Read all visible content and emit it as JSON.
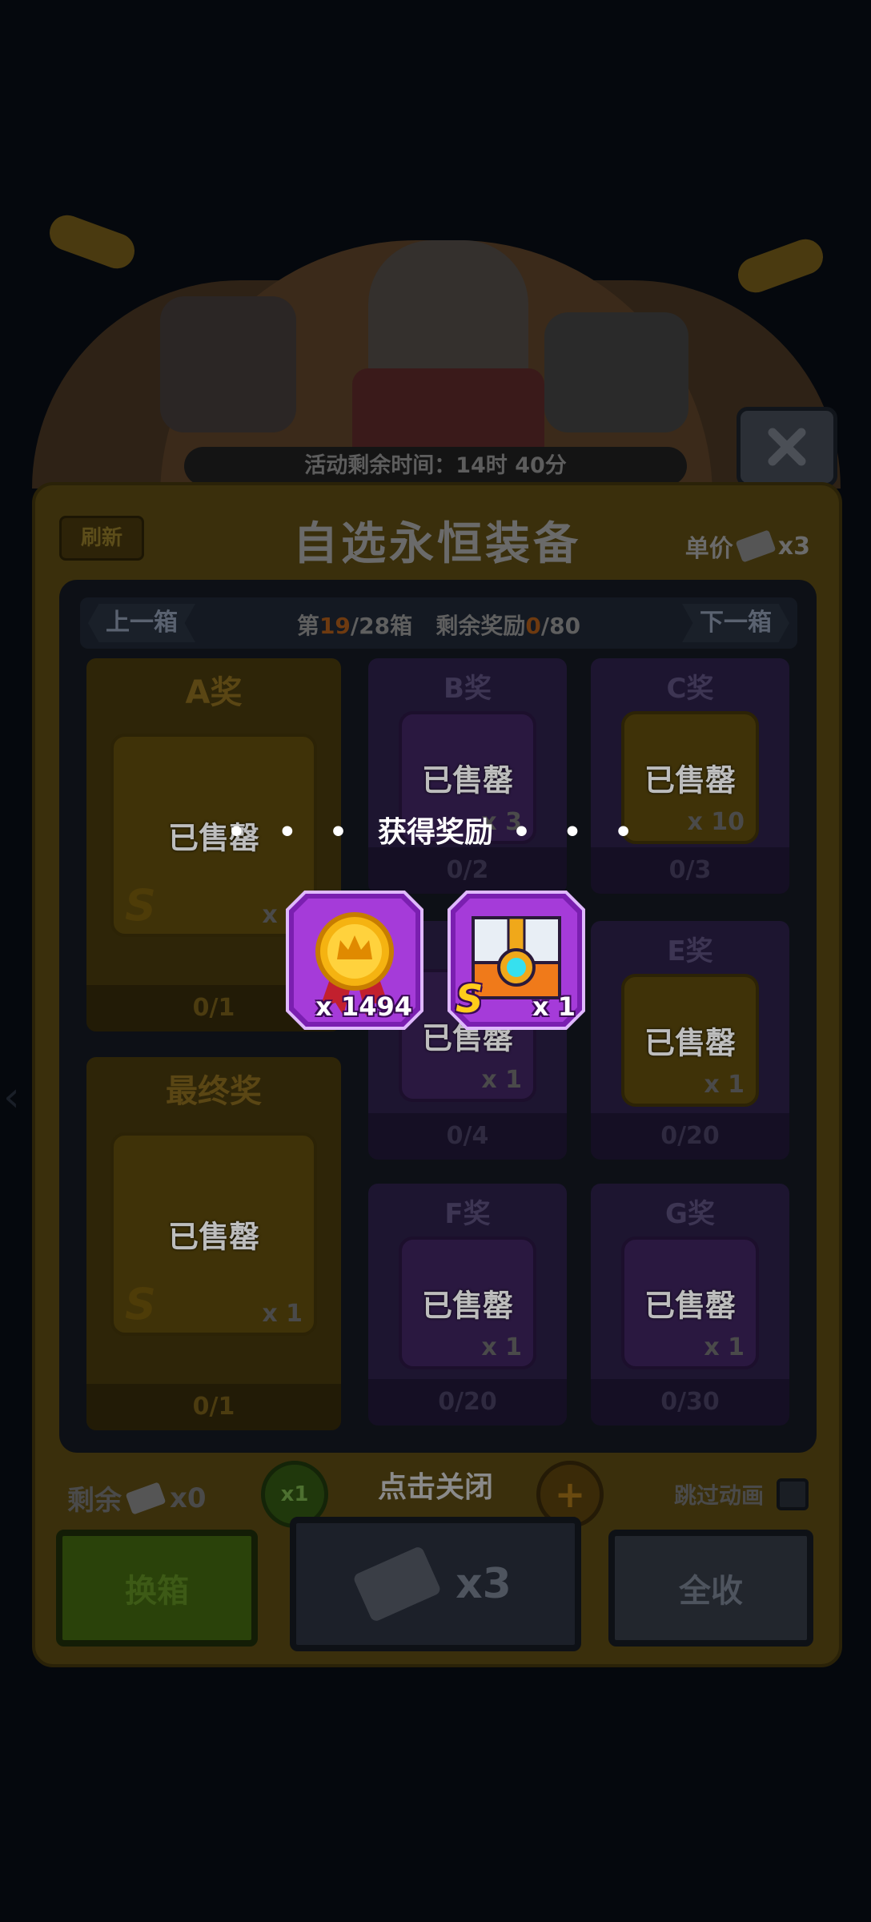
{
  "header": {
    "timer_text": "活动剩余时间：14时 40分"
  },
  "panel": {
    "refresh_label": "刷新",
    "title": "自选永恒装备",
    "unit_price_label": "单价",
    "unit_price_qty": "x3"
  },
  "nav": {
    "prev_label": "上一箱",
    "next_label": "下一箱",
    "box_prefix": "第",
    "box_current": "19",
    "box_suffix": "/28箱",
    "reward_prefix": "剩余奖励",
    "reward_current": "0",
    "reward_suffix": "/80"
  },
  "prizes": {
    "a": {
      "title": "A奖",
      "status": "已售罄",
      "qty": "x 1",
      "grade": "S",
      "count": "0/1"
    },
    "b": {
      "title": "B奖",
      "status": "已售罄",
      "qty": "x 3",
      "count": "0/2"
    },
    "c": {
      "title": "C奖",
      "status": "已售罄",
      "qty": "x 10",
      "count": "0/3"
    },
    "d": {
      "status": "已售罄",
      "qty": "x 1",
      "count": "0/4"
    },
    "e": {
      "title": "E奖",
      "status": "已售罄",
      "qty": "x 1",
      "count": "0/20"
    },
    "final": {
      "title": "最终奖",
      "status": "已售罄",
      "qty": "x 1",
      "grade": "S",
      "count": "0/1"
    },
    "f": {
      "title": "F奖",
      "status": "已售罄",
      "qty": "x 1",
      "count": "0/20"
    },
    "g": {
      "title": "G奖",
      "status": "已售罄",
      "qty": "x 1",
      "count": "0/30"
    }
  },
  "bottom": {
    "remain_label": "剩余",
    "remain_qty": "x0",
    "minus_label": "x1",
    "plus_label": "+",
    "tap_close": "点击关闭",
    "skip_label": "跳过动画",
    "swap_label": "换箱",
    "draw_qty": "x3",
    "collect_all_label": "全收"
  },
  "popup": {
    "title": "获得奖励",
    "dots": "• • •",
    "rewards": [
      {
        "name": "crown medal",
        "qty": "x 1494"
      },
      {
        "name": "equipment chest",
        "grade": "S",
        "qty": "x 1"
      }
    ]
  },
  "colors": {
    "reward_purple": "#a53bd9",
    "reward_border": "#5c1687",
    "medal_gold": "#f5b311"
  }
}
